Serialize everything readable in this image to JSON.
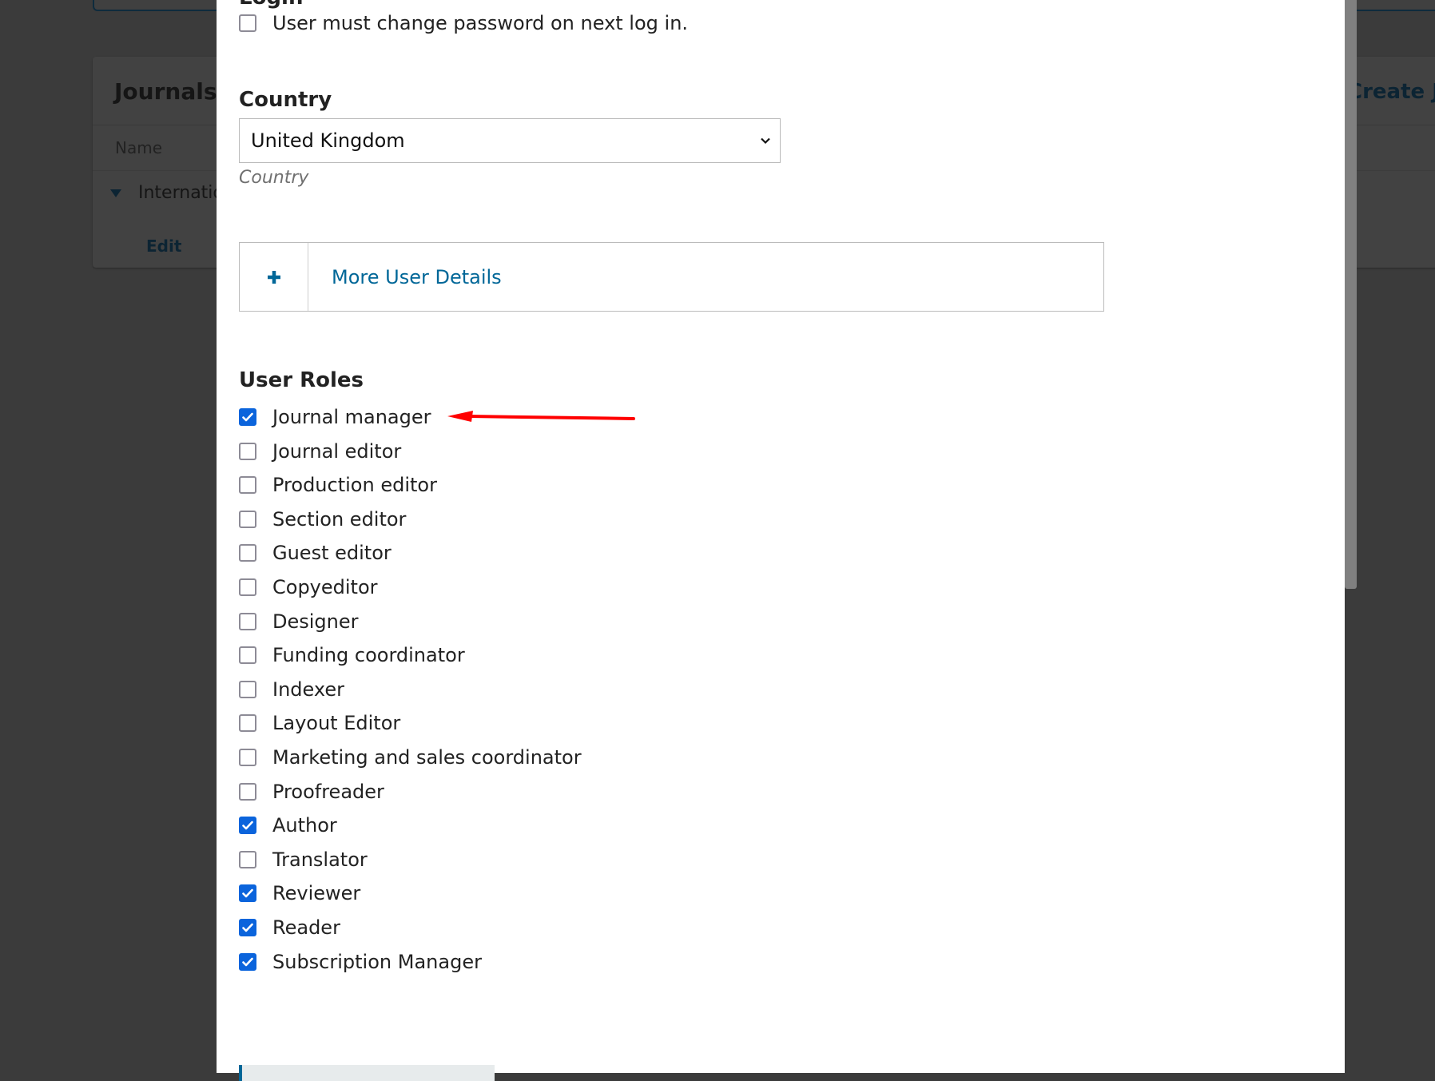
{
  "background_page": {
    "panel_title": "Journals",
    "create_button": "Create Journal",
    "column_name": "Name",
    "row_name": "International",
    "row_action": "Edit"
  },
  "modal": {
    "partial_label": "Login",
    "change_password": {
      "label": "User must change password on next log in.",
      "checked": false
    },
    "country": {
      "label": "Country",
      "selected": "United Kingdom",
      "help": "Country"
    },
    "more_details": {
      "icon": "plus-icon",
      "label": "More User Details"
    },
    "user_roles": {
      "heading": "User Roles",
      "items": [
        {
          "label": "Journal manager",
          "checked": true
        },
        {
          "label": "Journal editor",
          "checked": false
        },
        {
          "label": "Production editor",
          "checked": false
        },
        {
          "label": "Section editor",
          "checked": false
        },
        {
          "label": "Guest editor",
          "checked": false
        },
        {
          "label": "Copyeditor",
          "checked": false
        },
        {
          "label": "Designer",
          "checked": false
        },
        {
          "label": "Funding coordinator",
          "checked": false
        },
        {
          "label": "Indexer",
          "checked": false
        },
        {
          "label": "Layout Editor",
          "checked": false
        },
        {
          "label": "Marketing and sales coordinator",
          "checked": false
        },
        {
          "label": "Proofreader",
          "checked": false
        },
        {
          "label": "Author",
          "checked": true
        },
        {
          "label": "Translator",
          "checked": false
        },
        {
          "label": "Reviewer",
          "checked": true
        },
        {
          "label": "Reader",
          "checked": true
        },
        {
          "label": "Subscription Manager",
          "checked": true
        }
      ]
    },
    "annotation": {
      "type": "red-arrow",
      "color": "#ff0000",
      "points_to": "Journal manager"
    }
  },
  "colors": {
    "overlay": "#3b3b3b",
    "checkbox_checked": "#0b64dc",
    "link": "#006798"
  }
}
